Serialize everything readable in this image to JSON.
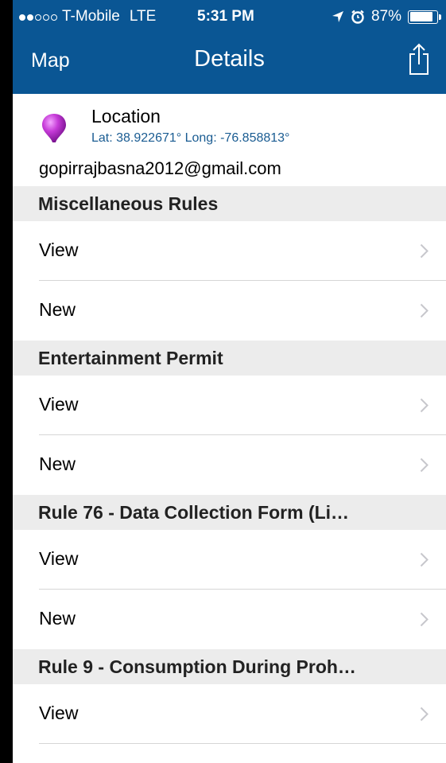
{
  "status_bar": {
    "signal_bars_filled": 2,
    "signal_bars_total": 5,
    "carrier": "T-Mobile",
    "network": "LTE",
    "time": "5:31 PM",
    "battery": "87%",
    "battery_level": 0.87
  },
  "nav": {
    "back_label": "Map",
    "title": "Details"
  },
  "location": {
    "title": "Location",
    "coords": "Lat: 38.922671° Long: -76.858813°",
    "email": "gopirrajbasna2012@gmail.com",
    "pin_color": "#c63bd8"
  },
  "sections": [
    {
      "title": "Miscellaneous Rules",
      "rows": [
        "View",
        "New"
      ]
    },
    {
      "title": "Entertainment Permit",
      "rows": [
        "View",
        "New"
      ]
    },
    {
      "title": "Rule 76 - Data Collection Form (Li…",
      "rows": [
        "View",
        "New"
      ]
    },
    {
      "title": "Rule 9 - Consumption During Proh…",
      "rows": [
        "View"
      ]
    }
  ],
  "colors": {
    "header": "#0a5694",
    "section_bg": "#ececec",
    "coords_text": "#1a5c92"
  }
}
